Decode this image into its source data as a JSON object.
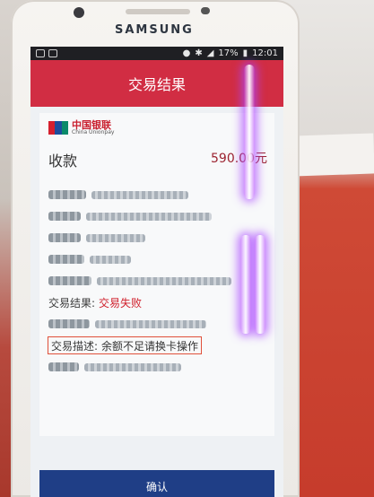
{
  "device": {
    "brand": "SAMSUNG"
  },
  "status_bar": {
    "battery": "17%",
    "time": "12:01"
  },
  "app": {
    "title": "交易结果"
  },
  "logo": {
    "cn": "中国银联",
    "en": "China Unionpay"
  },
  "receipt": {
    "heading": "收款",
    "amount": "590.00元",
    "rows": [
      {
        "label": "商户名称",
        "value": ""
      },
      {
        "label": "商户号",
        "value": ""
      },
      {
        "label": "终端号",
        "value": ""
      },
      {
        "label": "发卡行",
        "value": ""
      },
      {
        "label": "交易卡号",
        "value": ""
      },
      {
        "label": "交易结果:",
        "value": "交易失败"
      },
      {
        "label": "交易时间",
        "value": ""
      },
      {
        "label": "交易描述:",
        "value": "余额不足请换卡操作"
      },
      {
        "label": "参考号",
        "value": ""
      }
    ]
  },
  "buttons": {
    "confirm": "确认"
  },
  "colors": {
    "title_bar": "#d12d43",
    "confirm_button": "#1f3e86",
    "fail_text": "#d0202c"
  }
}
